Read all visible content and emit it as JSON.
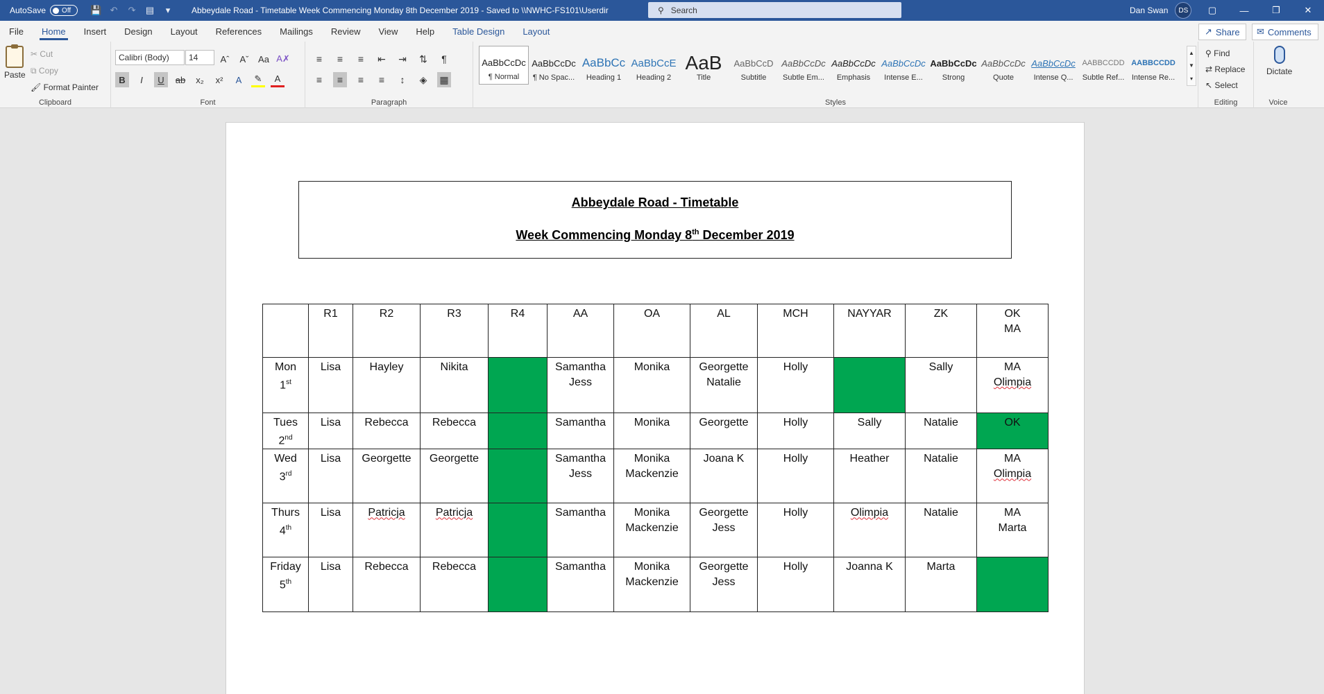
{
  "titlebar": {
    "autosave_label": "AutoSave",
    "autosave_state": "Off",
    "doc_title": "Abbeydale Road - Timetable Week Commencing Monday 8th December 2019  -  Saved to \\\\NWHC-FS101\\Userdir",
    "search_placeholder": "Search",
    "user_name": "Dan Swan",
    "user_initials": "DS"
  },
  "menu": {
    "tabs": [
      "File",
      "Home",
      "Insert",
      "Design",
      "Layout",
      "References",
      "Mailings",
      "Review",
      "View",
      "Help",
      "Table Design",
      "Layout"
    ],
    "share": "Share",
    "comments": "Comments"
  },
  "ribbon": {
    "clipboard": {
      "paste": "Paste",
      "cut": "Cut",
      "copy": "Copy",
      "format_painter": "Format Painter",
      "label": "Clipboard"
    },
    "font": {
      "name": "Calibri (Body)",
      "size": "14",
      "label": "Font"
    },
    "paragraph": {
      "label": "Paragraph"
    },
    "styles": {
      "label": "Styles",
      "items": [
        {
          "preview": "AaBbCcDc",
          "name": "¶ Normal"
        },
        {
          "preview": "AaBbCcDc",
          "name": "¶ No Spac..."
        },
        {
          "preview": "AaBbCc",
          "name": "Heading 1"
        },
        {
          "preview": "AaBbCcE",
          "name": "Heading 2"
        },
        {
          "preview": "AaB",
          "name": "Title"
        },
        {
          "preview": "AaBbCcD",
          "name": "Subtitle"
        },
        {
          "preview": "AaBbCcDc",
          "name": "Subtle Em..."
        },
        {
          "preview": "AaBbCcDc",
          "name": "Emphasis"
        },
        {
          "preview": "AaBbCcDc",
          "name": "Intense E..."
        },
        {
          "preview": "AaBbCcDc",
          "name": "Strong"
        },
        {
          "preview": "AaBbCcDc",
          "name": "Quote"
        },
        {
          "preview": "AaBbCcDc",
          "name": "Intense Q..."
        },
        {
          "preview": "AABBCCDD",
          "name": "Subtle Ref..."
        },
        {
          "preview": "AABBCCDD",
          "name": "Intense Re..."
        }
      ]
    },
    "editing": {
      "find": "Find",
      "replace": "Replace",
      "select": "Select",
      "label": "Editing"
    },
    "voice": {
      "dictate": "Dictate",
      "label": "Voice"
    }
  },
  "document": {
    "title_line1": "Abbeydale Road - Timetable",
    "title_line2_pre": "Week Commencing Monday 8",
    "title_line2_sup": "th",
    "title_line2_post": " December 2019",
    "headers": [
      "",
      "R1",
      "R2",
      "R3",
      "R4",
      "AA",
      "OA",
      "AL",
      "MCH",
      "NAYYAR",
      "ZK",
      "OK\nMA"
    ],
    "rows": [
      {
        "day": "Mon",
        "date": "1",
        "sup": "st",
        "cells": [
          "Lisa",
          "Hayley",
          "Nikita",
          "",
          "Samantha\nJess",
          "Monika",
          "Georgette\nNatalie",
          "Holly",
          "",
          "Sally",
          "MA\nOlimpia"
        ]
      },
      {
        "day": "Tues",
        "date": "2",
        "sup": "nd",
        "cells": [
          "Lisa",
          "Rebecca",
          "Rebecca",
          "",
          "Samantha",
          "Monika",
          "Georgette",
          "Holly",
          "Sally",
          "Natalie",
          "OK"
        ]
      },
      {
        "day": "Wed",
        "date": "3",
        "sup": "rd",
        "cells": [
          "Lisa",
          "Georgette",
          "Georgette",
          "",
          "Samantha\nJess",
          "Monika\nMackenzie",
          "Joana K",
          "Holly",
          "Heather",
          "Natalie",
          "MA\nOlimpia"
        ]
      },
      {
        "day": "Thurs",
        "date": "4",
        "sup": "th",
        "cells": [
          "Lisa",
          "Patricja",
          "Patricja",
          "",
          "Samantha",
          "Monika\nMackenzie",
          "Georgette\nJess",
          "Holly",
          "Olimpia",
          "Natalie",
          "MA\nMarta"
        ]
      },
      {
        "day": "Friday",
        "date": "5",
        "sup": "th",
        "cells": [
          "Lisa",
          "Rebecca",
          "Rebecca",
          "",
          "Samantha",
          "Monika\nMackenzie",
          "Georgette\nJess",
          "Holly",
          "Joanna K",
          "Marta",
          ""
        ]
      }
    ],
    "green_color": "#00a651"
  }
}
